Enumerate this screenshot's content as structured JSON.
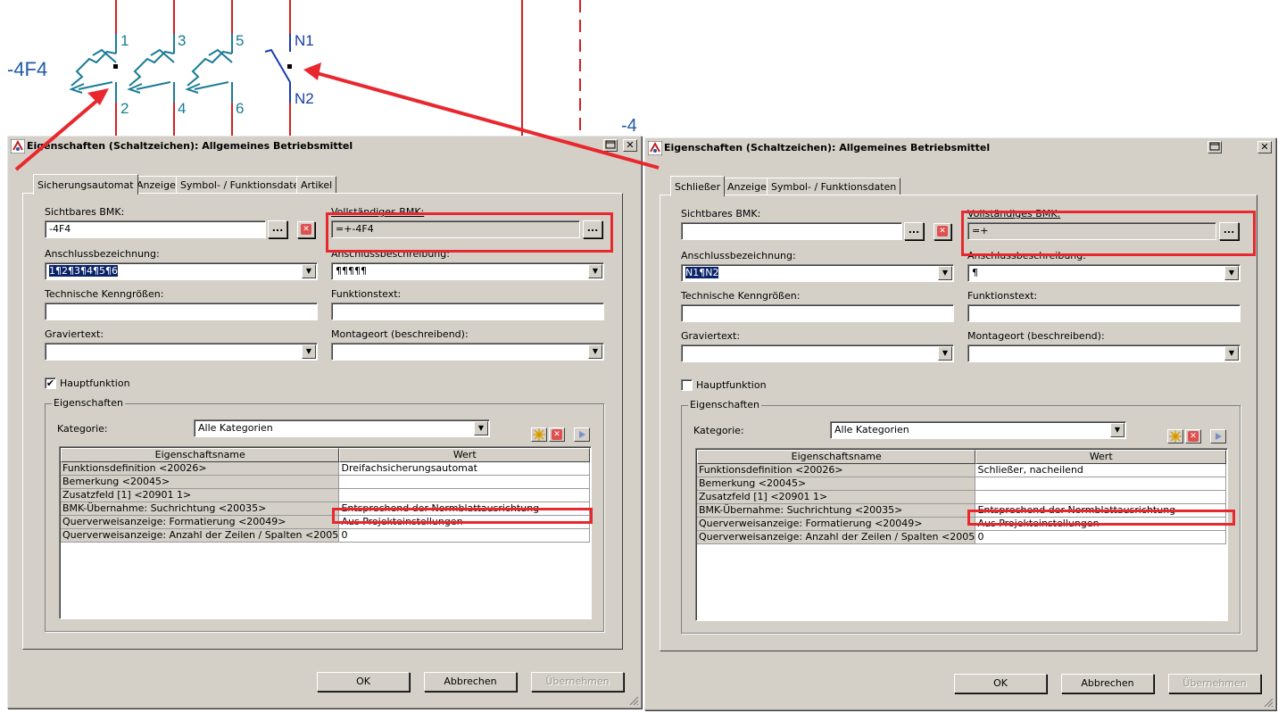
{
  "schematic": {
    "device_label": "-4F4",
    "device_label_2": "-4",
    "terminals_top": [
      "1",
      "3",
      "5",
      "N1"
    ],
    "terminals_bottom": [
      "2",
      "4",
      "6",
      "N2"
    ]
  },
  "left_dialog": {
    "title": "Eigenschaften (Schaltzeichen): Allgemeines Betriebsmittel",
    "close_glyph": "✕",
    "tabs": [
      "Sicherungsautomat",
      "Anzeige",
      "Symbol- / Funktionsdaten",
      "Artikel"
    ],
    "labels": {
      "sichtbares_bmk": "Sichtbares BMK:",
      "vollstaendiges_bmk": "Vollständiges BMK:",
      "anschlussbezeichnung": "Anschlussbezeichnung:",
      "anschlussbeschreibung": "Anschlussbeschreibung:",
      "technische": "Technische Kenngrößen:",
      "funktionstext": "Funktionstext:",
      "graviertext": "Graviertext:",
      "montageort": "Montageort (beschreibend):",
      "hauptfunktion": "Hauptfunktion",
      "eigenschaften": "Eigenschaften",
      "kategorie": "Kategorie:"
    },
    "values": {
      "sichtbares_bmk": "-4F4",
      "vollstaendiges_bmk": "=+-4F4",
      "anschlussbezeichnung": "1¶2¶3¶4¶5¶6",
      "anschlussbeschreibung": "¶¶¶¶¶",
      "technische": "",
      "funktionstext": "",
      "graviertext": "",
      "montageort": "",
      "kategorie": "Alle Kategorien"
    },
    "hauptfunktion_checked": true,
    "check_glyph": "✔",
    "ellipsis": "...",
    "columns": [
      "Eigenschaftsname",
      "Wert"
    ],
    "rows": [
      {
        "name": "Funktionsdefinition <20026>",
        "value": "Dreifachsicherungsautomat"
      },
      {
        "name": "Bemerkung <20045>",
        "value": ""
      },
      {
        "name": "Zusatzfeld [1] <20901 1>",
        "value": ""
      },
      {
        "name": "BMK-Übernahme: Suchrichtung <20035>",
        "value": "Entsprechend der Normblattausrichtung"
      },
      {
        "name": "Querverweisanzeige: Formatierung <20049>",
        "value": "Aus Projekteinstellungen"
      },
      {
        "name": "Querverweisanzeige: Anzahl der Zeilen / Spalten <20050>",
        "value": "0"
      }
    ],
    "buttons": {
      "ok": "OK",
      "cancel": "Abbrechen",
      "apply": "Übernehmen"
    }
  },
  "right_dialog": {
    "title": "Eigenschaften (Schaltzeichen): Allgemeines Betriebsmittel",
    "close_glyph": "✕",
    "tabs": [
      "Schließer",
      "Anzeige",
      "Symbol- / Funktionsdaten"
    ],
    "labels": {
      "sichtbares_bmk": "Sichtbares BMK:",
      "vollstaendiges_bmk": "Vollständiges BMK:",
      "anschlussbezeichnung": "Anschlussbezeichnung:",
      "anschlussbeschreibung": "Anschlussbeschreibung:",
      "technische": "Technische Kenngrößen:",
      "funktionstext": "Funktionstext:",
      "graviertext": "Graviertext:",
      "montageort": "Montageort (beschreibend):",
      "hauptfunktion": "Hauptfunktion",
      "eigenschaften": "Eigenschaften",
      "kategorie": "Kategorie:"
    },
    "values": {
      "sichtbares_bmk": "",
      "vollstaendiges_bmk": "=+",
      "anschlussbezeichnung": "N1¶N2",
      "anschlussbeschreibung": "¶",
      "technische": "",
      "funktionstext": "",
      "graviertext": "",
      "montageort": "",
      "kategorie": "Alle Kategorien"
    },
    "hauptfunktion_checked": false,
    "ellipsis": "...",
    "columns": [
      "Eigenschaftsname",
      "Wert"
    ],
    "rows": [
      {
        "name": "Funktionsdefinition <20026>",
        "value": "Schließer, nacheilend"
      },
      {
        "name": "Bemerkung <20045>",
        "value": ""
      },
      {
        "name": "Zusatzfeld [1] <20901 1>",
        "value": ""
      },
      {
        "name": "BMK-Übernahme: Suchrichtung <20035>",
        "value": "Entsprechend der Normblattausrichtung"
      },
      {
        "name": "Querverweisanzeige: Formatierung <20049>",
        "value": "Aus Projekteinstellungen"
      },
      {
        "name": "Querverweisanzeige: Anzahl der Zeilen / Spalten <20050>",
        "value": "0"
      }
    ],
    "buttons": {
      "ok": "OK",
      "cancel": "Abbrechen",
      "apply": "Übernehmen"
    }
  },
  "colors": {
    "annotation_red": "#e8282e",
    "wire_red": "#d42020",
    "symbol_teal": "#1a7c96",
    "label_blue": "#1e5aa8",
    "selection_blue": "#0a246a",
    "dialog_gray": "#d4d0c8"
  }
}
